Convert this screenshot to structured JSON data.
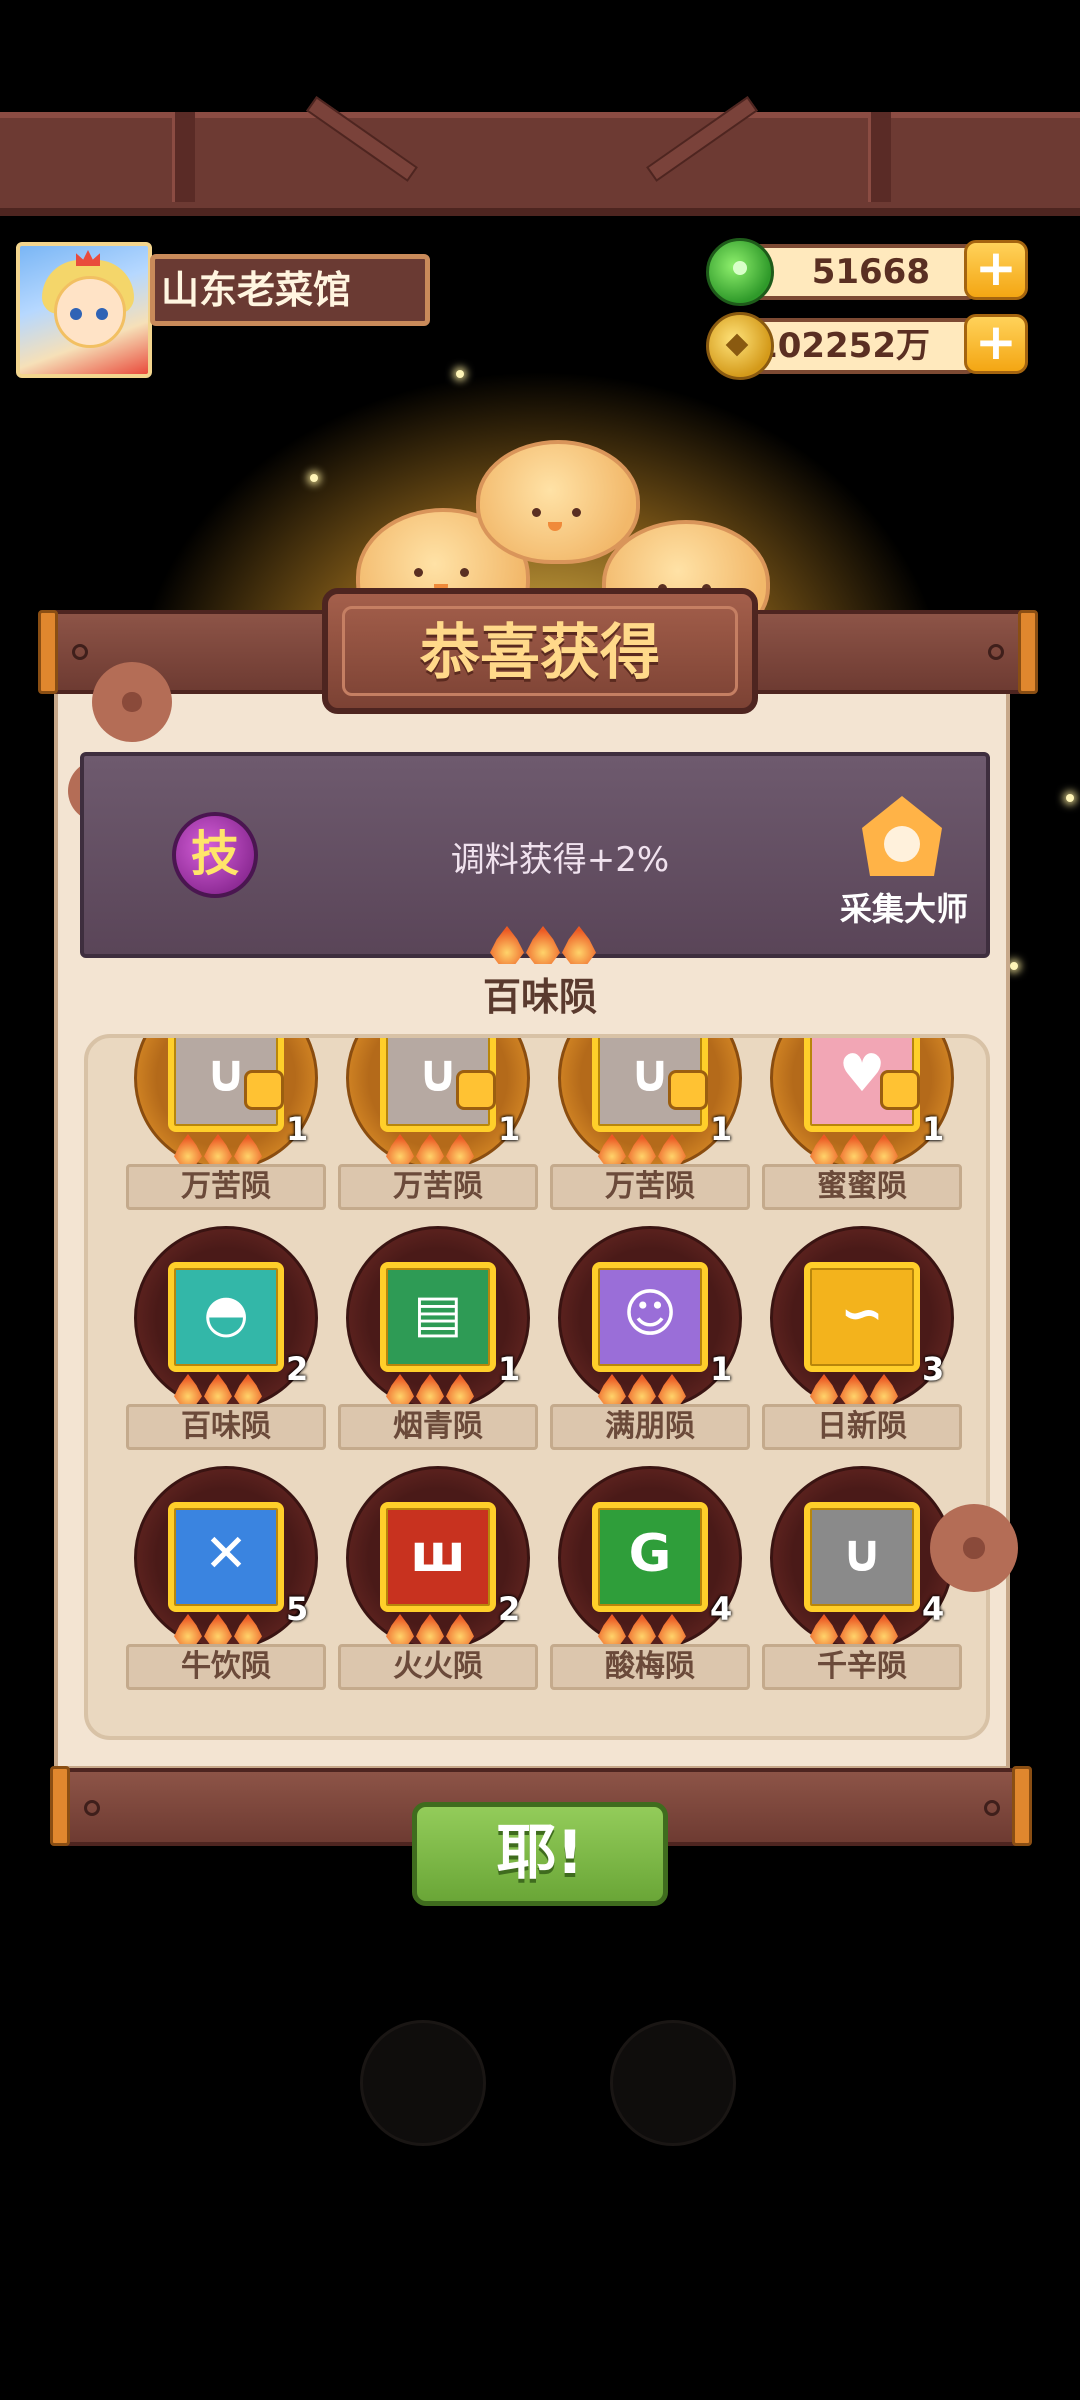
{
  "header": {
    "player_name": "山东老菜馆"
  },
  "currencies": {
    "jade": {
      "value": "51668",
      "icon": "jade-icon"
    },
    "gold": {
      "value": "102252万",
      "icon": "coin-icon"
    }
  },
  "reward": {
    "title": "恭喜获得",
    "skill_badge": "技",
    "skill_text": "调料获得+2%",
    "master_label": "采集大师",
    "collection_name": "百味陨"
  },
  "items": [
    {
      "label": "万苦陨",
      "qty": "1",
      "color": "#b6a9a2",
      "glyph": "∪"
    },
    {
      "label": "万苦陨",
      "qty": "1",
      "color": "#b6a9a2",
      "glyph": "∪"
    },
    {
      "label": "万苦陨",
      "qty": "1",
      "color": "#b6a9a2",
      "glyph": "∪"
    },
    {
      "label": "蜜蜜陨",
      "qty": "1",
      "color": "#f2a6b5",
      "glyph": "♥"
    },
    {
      "label": "百味陨",
      "qty": "2",
      "color": "#33b7a8",
      "glyph": "◓"
    },
    {
      "label": "烟青陨",
      "qty": "1",
      "color": "#2e9b55",
      "glyph": "▤"
    },
    {
      "label": "满朋陨",
      "qty": "1",
      "color": "#9a6ed8",
      "glyph": "☺"
    },
    {
      "label": "日新陨",
      "qty": "3",
      "color": "#f3b31c",
      "glyph": "∽"
    },
    {
      "label": "牛饮陨",
      "qty": "5",
      "color": "#3a84e0",
      "glyph": "✕"
    },
    {
      "label": "火火陨",
      "qty": "2",
      "color": "#c8321f",
      "glyph": "ш"
    },
    {
      "label": "酸梅陨",
      "qty": "4",
      "color": "#2f9e3a",
      "glyph": "G"
    },
    {
      "label": "千辛陨",
      "qty": "4",
      "color": "#8a8a8a",
      "glyph": "∪"
    }
  ],
  "confirm": {
    "label": "耶!"
  }
}
